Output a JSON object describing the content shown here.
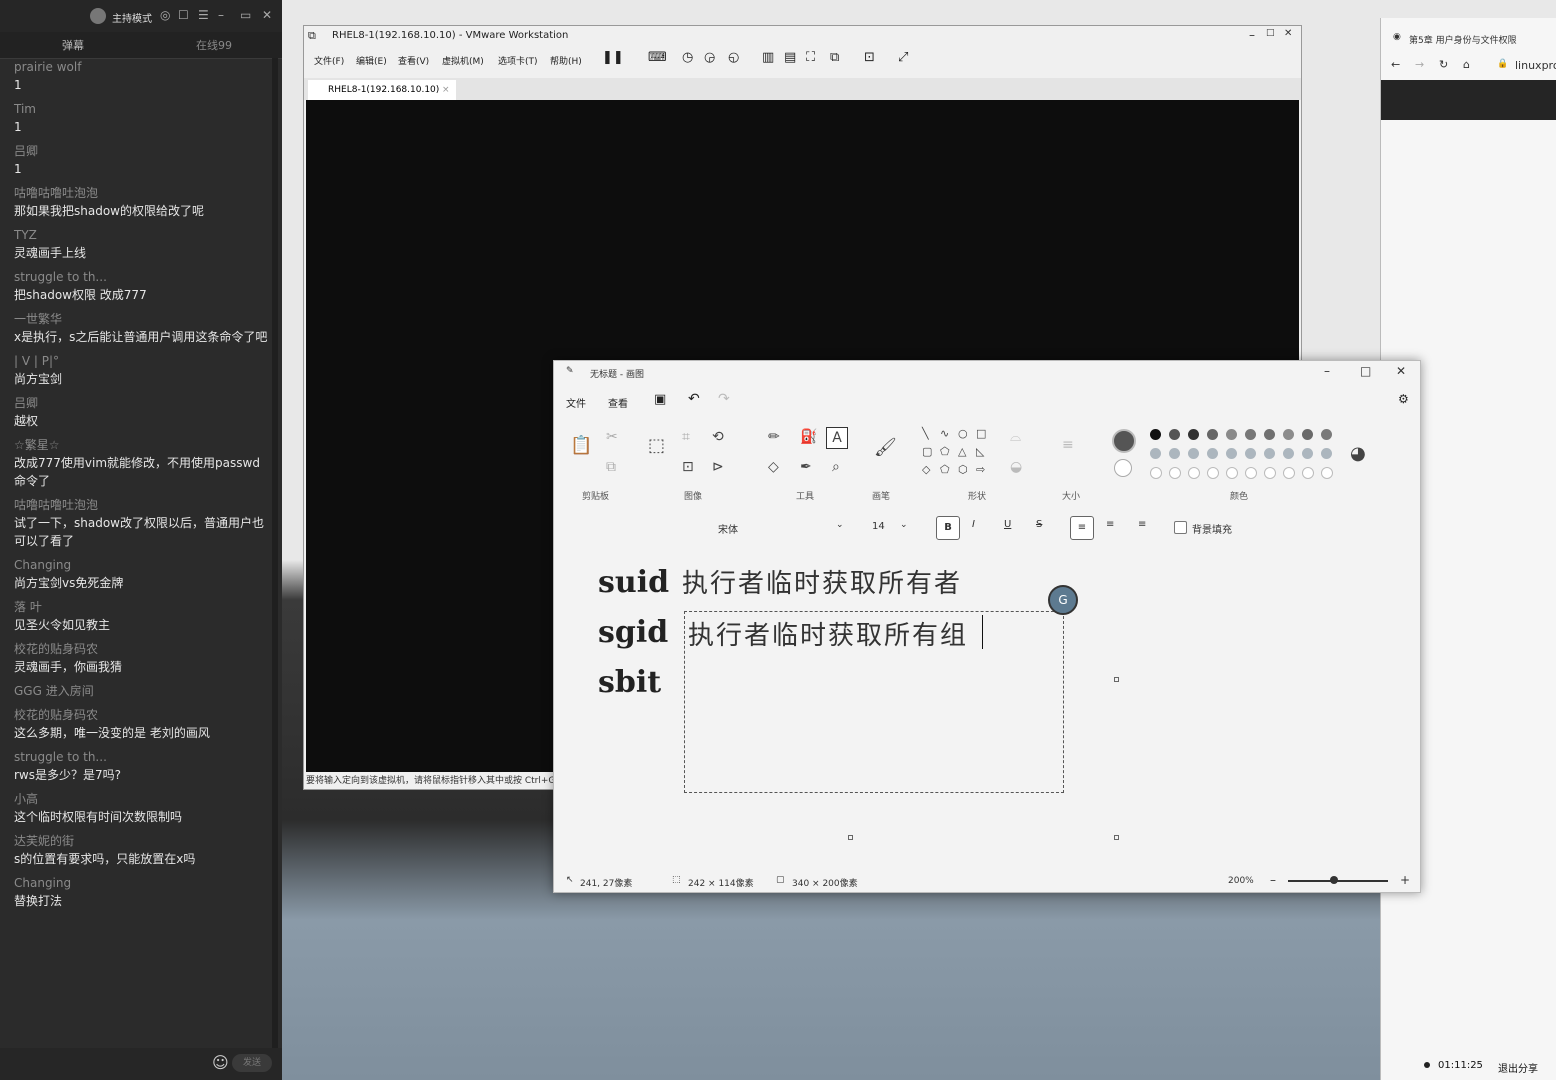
{
  "chat": {
    "header_mode": "主持模式",
    "tabs": [
      "弹幕",
      "在线99"
    ],
    "messages": [
      {
        "user": "prairie wolf",
        "text": "1"
      },
      {
        "user": "Tim",
        "text": "1"
      },
      {
        "user": "吕卿",
        "text": "1"
      },
      {
        "user": "咕噜咕噜吐泡泡",
        "text": "那如果我把shadow的权限给改了呢"
      },
      {
        "user": "TYZ",
        "text": "灵魂画手上线"
      },
      {
        "user": "struggle to th...",
        "text": "把shadow权限 改成777"
      },
      {
        "user": "一世繁华",
        "text": "x是执行，s之后能让普通用户调用这条命令了吧"
      },
      {
        "user": "|    V    |    P|°",
        "text": "尚方宝剑"
      },
      {
        "user": "吕卿",
        "text": "越权"
      },
      {
        "user": "☆繁星☆",
        "text": "改成777使用vim就能修改，不用使用passwd命令了"
      },
      {
        "user": "咕噜咕噜吐泡泡",
        "text": "试了一下，shadow改了权限以后，普通用户也可以了看了"
      },
      {
        "user": "Changing",
        "text": "尚方宝剑vs免死金牌"
      },
      {
        "user": "落  叶",
        "text": "见圣火令如见教主"
      },
      {
        "user": "校花的贴身码农",
        "text": "灵魂画手，你画我猜"
      },
      {
        "user": "GGG 进入房间",
        "text": ""
      },
      {
        "user": "校花的贴身码农",
        "text": "这么多期，唯一没变的是 老刘的画风"
      },
      {
        "user": "struggle to th...",
        "text": "rws是多少？是7吗?"
      },
      {
        "user": "小高",
        "text": "这个临时权限有时间次数限制吗"
      },
      {
        "user": "达芙妮的街",
        "text": "s的位置有要求吗，只能放置在x吗"
      },
      {
        "user": "Changing",
        "text": "替换打法"
      }
    ],
    "input_placeholder": "发送"
  },
  "vmware": {
    "title": "RHEL8-1(192.168.10.10) - VMware Workstation",
    "menu": [
      "文件(F)",
      "编辑(E)",
      "查看(V)",
      "虚拟机(M)",
      "选项卡(T)",
      "帮助(H)"
    ],
    "tab": "RHEL8-1(192.168.10.10)",
    "status": "要将输入定向到该虚拟机，请将鼠标指针移入其中或按 Ctrl+G。"
  },
  "browser": {
    "tab_title": "第5章 用户身份与文件权限",
    "url": "linuxpro"
  },
  "paint": {
    "title": "无标题 - 画图",
    "menu": [
      "文件",
      "查看"
    ],
    "groups": [
      "剪贴板",
      "图像",
      "工具",
      "画笔",
      "形状",
      "大小",
      "颜色"
    ],
    "font_name": "宋体",
    "font_size": "14",
    "fill_label": "背景填充",
    "canvas_lines": [
      {
        "label": "suid",
        "desc": "执行者临时获取所有者"
      },
      {
        "label": "sgid",
        "desc": "执行者临时获取所有组"
      },
      {
        "label": "sbit",
        "desc": ""
      }
    ],
    "status_pos": "241, 27像素",
    "status_sel": "242 × 114像素",
    "status_size": "340 × 200像素",
    "zoom": "200%",
    "colors": [
      "#111111",
      "#555555",
      "#333333",
      "#666666",
      "#8a8a8a",
      "#777777",
      "#707070",
      "#8c8c8c",
      "#6a6a6a",
      "#7a7a7a"
    ]
  },
  "taskbar": {
    "time": "01:11:25",
    "exit_share": "退出分享"
  }
}
